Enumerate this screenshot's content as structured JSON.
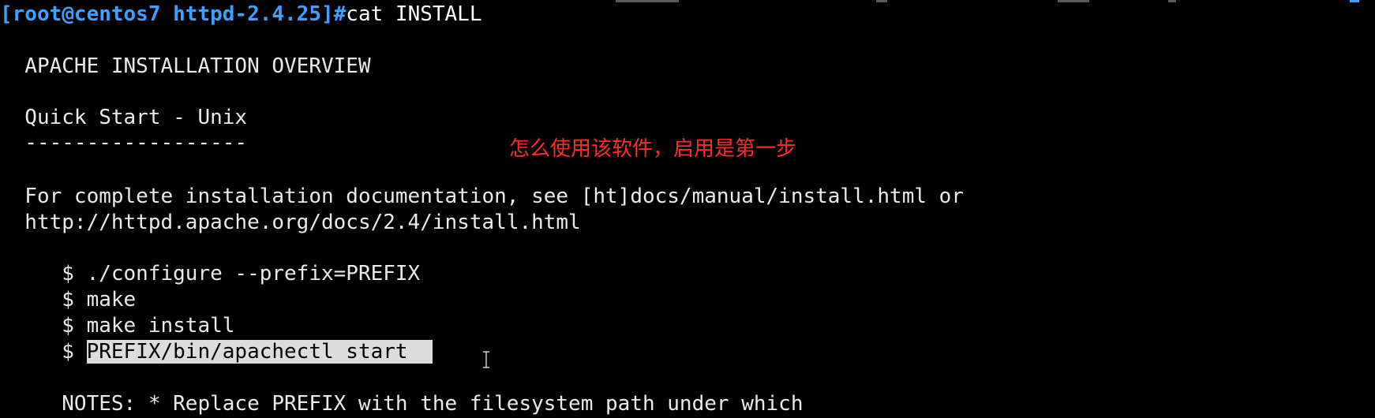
{
  "terminal": {
    "prompt": "[root@centos7 httpd-2.4.25]#",
    "command": "cat INSTALL",
    "lines": {
      "title": "  APACHE INSTALLATION OVERVIEW",
      "subtitle": "  Quick Start - Unix",
      "rule": "  ------------------",
      "doc1": "  For complete installation documentation, see [ht]docs/manual/install.html or",
      "doc2": "  http://httpd.apache.org/docs/2.4/install.html",
      "step1": "     $ ./configure --prefix=PREFIX",
      "step2": "     $ make",
      "step3": "     $ make install",
      "step4_prefix": "     $ ",
      "step4_selected": "PREFIX/bin/apachectl start  ",
      "notes": "     NOTES: * Replace PREFIX with the filesystem path under which"
    }
  },
  "annotation": {
    "text": "怎么使用该软件，启用是第一步",
    "color": "#ff2a2a"
  },
  "colors": {
    "background": "#000000",
    "prompt": "#3fa0ff",
    "text": "#eaeaea",
    "selection": "#dcdcdc"
  }
}
